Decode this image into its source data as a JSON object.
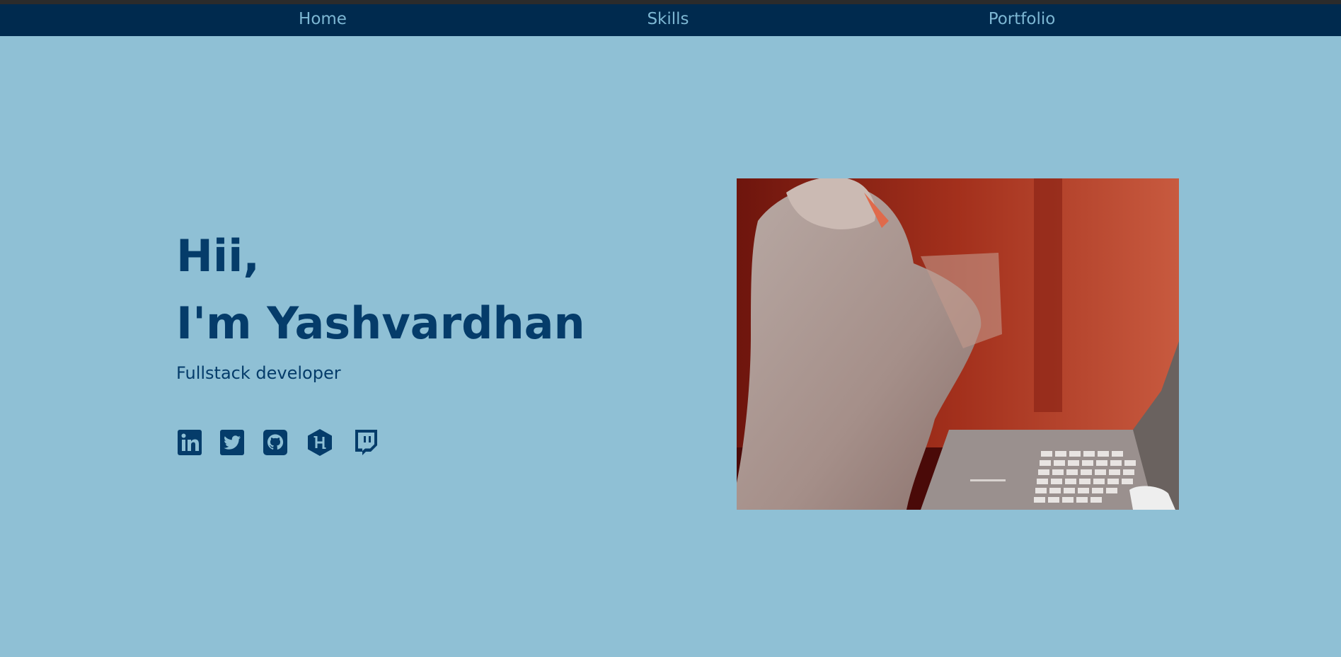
{
  "nav": {
    "items": [
      {
        "label": "Home"
      },
      {
        "label": "Skills"
      },
      {
        "label": "Portfolio"
      }
    ]
  },
  "hero": {
    "greeting": "Hii,",
    "name": "I'm Yashvardhan",
    "role": "Fullstack developer"
  },
  "social": {
    "icons": [
      "linkedin-icon",
      "twitter-icon",
      "github-icon",
      "hashnode-icon",
      "twitch-icon"
    ]
  },
  "image": {
    "subject": "cat-typing-on-laptop"
  },
  "colors": {
    "background": "#8fc0d5",
    "navbar": "#002a4e",
    "nav_text": "#7db7d3",
    "heading_text": "#053c6a",
    "icon": "#053c6a"
  }
}
